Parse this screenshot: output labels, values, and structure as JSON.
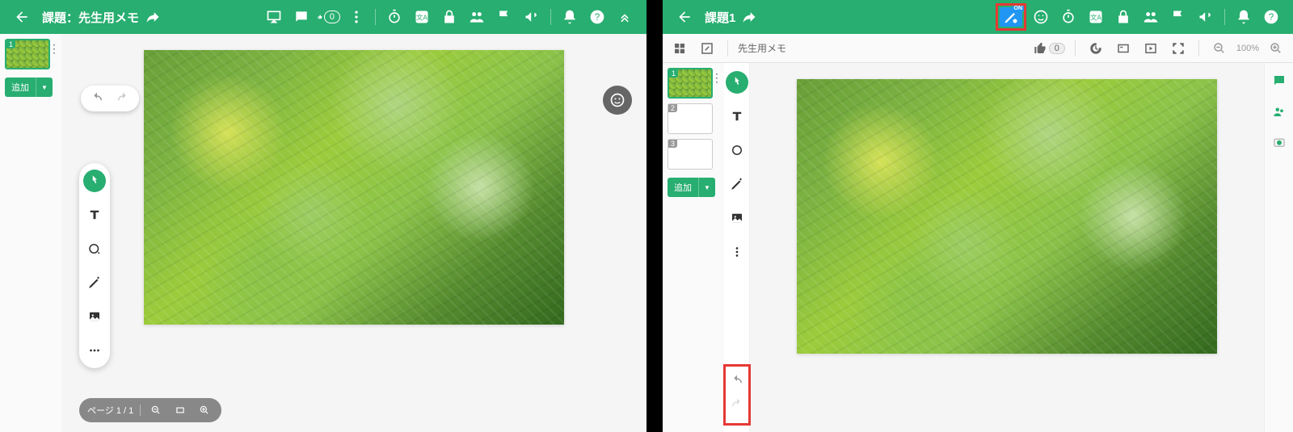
{
  "left": {
    "title": "課題：先生用メモ",
    "like_count": "0",
    "add_label": "追加",
    "page_indicator": "ページ 1 / 1",
    "thumbs": [
      {
        "num": "1"
      }
    ]
  },
  "right": {
    "title": "課題1",
    "memo_label": "先生用メモ",
    "like_count": "0",
    "zoom": "100%",
    "add_label": "追加",
    "on_badge": "ON",
    "thumbs": [
      {
        "num": "1"
      },
      {
        "num": "2"
      },
      {
        "num": "3"
      }
    ]
  }
}
